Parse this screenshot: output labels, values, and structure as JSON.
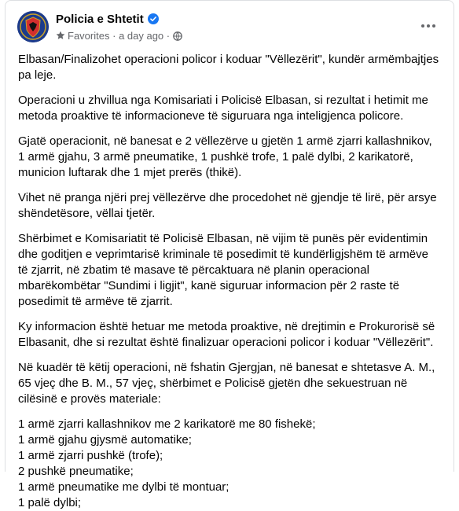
{
  "post": {
    "author": "Policia e Shtetit",
    "audience": "Favorites",
    "time": "a day ago",
    "separator": "·",
    "icons": {
      "avatar": "police-emblem-icon",
      "verified": "verified-badge-icon",
      "audience": "star-icon",
      "privacy": "globe-icon",
      "menu": "more-options-icon"
    },
    "colors": {
      "verified": "#1877f2",
      "meta": "#65676b"
    },
    "paragraphs": [
      "Elbasan/Finalizohet operacioni policor i koduar \"Vëllezërit\", kundër armëmbajtjes pa leje.",
      "Operacioni u zhvillua nga Komisariati i Policisë Elbasan, si rezultat i hetimit me metoda proaktive të informacioneve të siguruara nga inteligjenca policore.",
      "Gjatë operacionit, në banesat e 2 vëllezërve u gjetën 1 armë zjarri kallashnikov, 1 armë gjahu, 3 armë pneumatike, 1 pushkë trofe, 1 palë dylbi, 2 karikatorë, municion luftarak dhe 1 mjet prerës (thikë).",
      "Vihet në pranga njëri prej vëllezërve dhe procedohet në gjendje të lirë, për arsye shëndetësore, vëllai tjetër.",
      "Shërbimet e Komisariatit të Policisë Elbasan, në vijim të punës për evidentimin dhe goditjen e veprimtarisë kriminale të posedimit të kundërligjshëm të armëve të zjarrit, në zbatim të masave të përcaktuara në planin operacional mbarëkombëtar \"Sundimi i ligjit\", kanë siguruar informacion për 2 raste të posedimit të armëve të zjarrit.",
      "Ky informacion është hetuar me metoda proaktive, në drejtimin e Prokurorisë së Elbasanit, dhe si rezultat është finalizuar operacioni policor i koduar \"Vëllezërit\".",
      "Në kuadër të këtij operacioni, në fshatin Gjergjan, në banesat e shtetasve A. M., 65 vjeç dhe B. M., 57 vjeç, shërbimet e Policisë gjetën dhe sekuestruan në cilësinë e provës materiale:"
    ],
    "list": [
      "1 armë zjarri kallashnikov me 2 karikatorë me 80 fishekë;",
      "1 armë gjahu gjysmë automatike;",
      "1 armë zjarri pushkë (trofe);",
      "2 pushkë pneumatike;",
      "1 armë pneumatike me dylbi të montuar;",
      "1 palë dylbi;"
    ]
  }
}
